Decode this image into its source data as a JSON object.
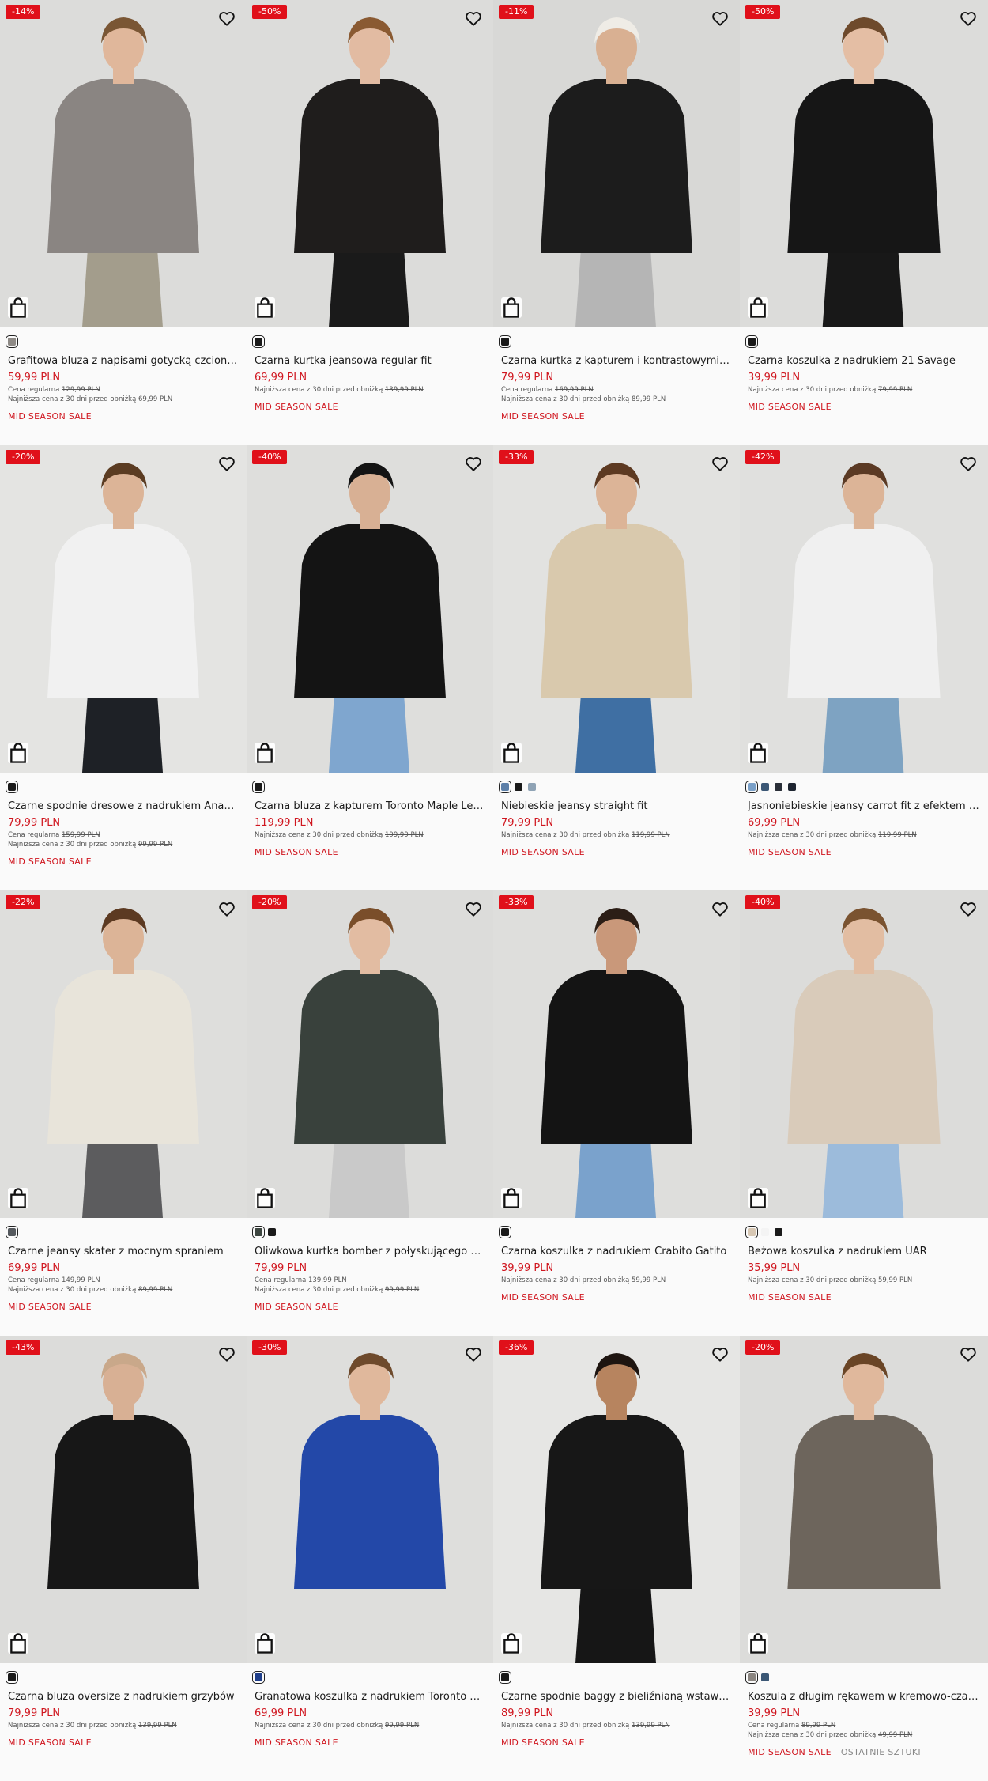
{
  "products": [
    {
      "discount": "-14%",
      "name": "Grafitowa bluza z napisami gotycką czcionką...",
      "price": "59,99 PLN",
      "regular_label": "Cena regularna",
      "regular": "129,99 PLN",
      "lowest_label": "Najniższa cena z 30 dni przed obniżką",
      "lowest": "69,99 PLN",
      "promo": "MID SEASON SALE",
      "swatches": [
        "#8e8a86"
      ],
      "bg": "#dcdcda",
      "top": "#8a8582",
      "bottom": "#a39d8c",
      "hair": "#7a5634",
      "skin": "#e0b79b",
      "legs": true
    },
    {
      "discount": "-50%",
      "name": "Czarna kurtka jeansowa regular fit",
      "price": "69,99 PLN",
      "lowest_label": "Najniższa cena z 30 dni przed obniżką",
      "lowest": "139,99 PLN",
      "promo": "MID SEASON SALE",
      "swatches": [
        "#1a1a1a"
      ],
      "bg": "#dcdcda",
      "top": "#1f1d1c",
      "bottom": "#1a1a1a",
      "hair": "#8a5a32",
      "skin": "#e2bba2",
      "legs": true
    },
    {
      "discount": "-11%",
      "name": "Czarna kurtka z kapturem i kontrastowymi ...",
      "price": "79,99 PLN",
      "regular_label": "Cena regularna",
      "regular": "169,99 PLN",
      "lowest_label": "Najniższa cena z 30 dni przed obniżką",
      "lowest": "89,99 PLN",
      "promo": "MID SEASON SALE",
      "swatches": [
        "#1a1a1a"
      ],
      "bg": "#d8d8d6",
      "top": "#1c1c1c",
      "bottom": "#b5b5b5",
      "hair": "#efece6",
      "skin": "#d9b092",
      "legs": true
    },
    {
      "discount": "-50%",
      "name": "Czarna koszulka z nadrukiem 21 Savage",
      "price": "39,99 PLN",
      "lowest_label": "Najniższa cena z 30 dni przed obniżką",
      "lowest": "79,99 PLN",
      "promo": "MID SEASON SALE",
      "swatches": [
        "#1a1a1a"
      ],
      "bg": "#dcdcda",
      "top": "#161616",
      "bottom": "#181818",
      "hair": "#6e4a2c",
      "skin": "#e4bea4",
      "legs": true
    },
    {
      "discount": "-20%",
      "name": "Czarne spodnie dresowe z nadrukiem Anah...",
      "price": "79,99 PLN",
      "regular_label": "Cena regularna",
      "regular": "159,99 PLN",
      "lowest_label": "Najniższa cena z 30 dni przed obniżką",
      "lowest": "99,99 PLN",
      "promo": "MID SEASON SALE",
      "swatches": [
        "#1a1a1a"
      ],
      "bg": "#e4e4e2",
      "top": "#f1f1f1",
      "bottom": "#1e2126",
      "hair": "#5b3c22",
      "skin": "#dcb497",
      "legs": true
    },
    {
      "discount": "-40%",
      "name": "Czarna bluza z kapturem Toronto Maple Leafs",
      "price": "119,99 PLN",
      "lowest_label": "Najniższa cena z 30 dni przed obniżką",
      "lowest": "199,99 PLN",
      "promo": "MID SEASON SALE",
      "swatches": [
        "#1a1a1a"
      ],
      "bg": "#dededc",
      "top": "#141414",
      "bottom": "#7fa6cf",
      "hair": "#141414",
      "skin": "#d8b094",
      "legs": true
    },
    {
      "discount": "-33%",
      "name": "Niebieskie jeansy straight fit",
      "price": "79,99 PLN",
      "lowest_label": "Najniższa cena z 30 dni przed obniżką",
      "lowest": "119,99 PLN",
      "promo": "MID SEASON SALE",
      "swatches": [
        "#5c7fa8",
        "#1a1a1a",
        "#8fa3b5"
      ],
      "bg": "#e2e2e0",
      "top": "#d9c9ad",
      "bottom": "#3f6fa3",
      "hair": "#5d3a22",
      "skin": "#dcb497",
      "legs": true
    },
    {
      "discount": "-42%",
      "name": "Jasnoniebieskie jeansy carrot fit z efektem s...",
      "price": "69,99 PLN",
      "lowest_label": "Najniższa cena z 30 dni przed obniżką",
      "lowest": "119,99 PLN",
      "promo": "MID SEASON SALE",
      "swatches": [
        "#7aa0c8",
        "#3b5775",
        "#2a2f38",
        "#1d2430"
      ],
      "bg": "#e0e0de",
      "top": "#f0f0f0",
      "bottom": "#7ea3c2",
      "hair": "#5b3a24",
      "skin": "#dcb497",
      "legs": true
    },
    {
      "discount": "-22%",
      "name": "Czarne jeansy skater z mocnym spraniem",
      "price": "69,99 PLN",
      "regular_label": "Cena regularna",
      "regular": "149,99 PLN",
      "lowest_label": "Najniższa cena z 30 dni przed obniżką",
      "lowest": "89,99 PLN",
      "promo": "MID SEASON SALE",
      "swatches": [
        "#55595e"
      ],
      "bg": "#dededc",
      "top": "#e8e4da",
      "bottom": "#5c5c5e",
      "hair": "#5c3a22",
      "skin": "#dcb497",
      "legs": true
    },
    {
      "discount": "-20%",
      "name": "Oliwkowa kurtka bomber z połyskującego m...",
      "price": "79,99 PLN",
      "regular_label": "Cena regularna",
      "regular": "139,99 PLN",
      "lowest_label": "Najniższa cena z 30 dni przed obniżką",
      "lowest": "99,99 PLN",
      "promo": "MID SEASON SALE",
      "swatches": [
        "#3d4640",
        "#1a1a1a"
      ],
      "bg": "#dcdcda",
      "top": "#39413c",
      "bottom": "#c9c9c9",
      "hair": "#7a4e2a",
      "skin": "#e2bca2",
      "legs": true
    },
    {
      "discount": "-33%",
      "name": "Czarna koszulka z nadrukiem Crabito Gatito",
      "price": "39,99 PLN",
      "lowest_label": "Najniższa cena z 30 dni przed obniżką",
      "lowest": "59,99 PLN",
      "promo": "MID SEASON SALE",
      "swatches": [
        "#1a1a1a"
      ],
      "bg": "#dededc",
      "top": "#141414",
      "bottom": "#7aa2cc",
      "hair": "#2c1e16",
      "skin": "#c9987a",
      "legs": true
    },
    {
      "discount": "-40%",
      "name": "Beżowa koszulka z nadrukiem UAR",
      "price": "35,99 PLN",
      "lowest_label": "Najniższa cena z 30 dni przed obniżką",
      "lowest": "59,99 PLN",
      "promo": "MID SEASON SALE",
      "swatches": [
        "#d7c7b3",
        "#f4f4f4",
        "#1a1a1a"
      ],
      "bg": "#dcdcda",
      "top": "#d9cbba",
      "bottom": "#9cbbdb",
      "hair": "#7a5330",
      "skin": "#e2bda2",
      "legs": true
    },
    {
      "discount": "-43%",
      "name": "Czarna bluza oversize z nadrukiem grzybów",
      "price": "79,99 PLN",
      "lowest_label": "Najniższa cena z 30 dni przed obniżką",
      "lowest": "139,99 PLN",
      "promo": "MID SEASON SALE",
      "swatches": [
        "#1a1a1a"
      ],
      "bg": "#dcdcda",
      "top": "#171717",
      "bottom": "#b7b4a6",
      "hair": "#c9a88a",
      "skin": "#d8b094",
      "legs": false
    },
    {
      "discount": "-30%",
      "name": "Granatowa koszulka z nadrukiem Toronto Ma...",
      "price": "69,99 PLN",
      "lowest_label": "Najniższa cena z 30 dni przed obniżką",
      "lowest": "99,99 PLN",
      "promo": "MID SEASON SALE",
      "swatches": [
        "#1f3e8a"
      ],
      "bg": "#dededc",
      "top": "#2348a8",
      "bottom": "#1a1a1a",
      "hair": "#6e4a2c",
      "skin": "#e0b89c",
      "legs": false
    },
    {
      "discount": "-36%",
      "name": "Czarne spodnie baggy z bieliźnianą wstawką...",
      "price": "89,99 PLN",
      "lowest_label": "Najniższa cena z 30 dni przed obniżką",
      "lowest": "139,99 PLN",
      "promo": "MID SEASON SALE",
      "swatches": [
        "#1a1a1a"
      ],
      "bg": "#e6e6e4",
      "top": "#171717",
      "bottom": "#161616",
      "hair": "#1e1510",
      "skin": "#b7845f",
      "legs": true
    },
    {
      "discount": "-20%",
      "name": "Koszula z długim rękawem w kremowo-czar...",
      "price": "39,99 PLN",
      "regular_label": "Cena regularna",
      "regular": "89,99 PLN",
      "lowest_label": "Najniższa cena z 30 dni przed obniżką",
      "lowest": "49,99 PLN",
      "promo": "MID SEASON SALE",
      "last": "OSTATNIE SZTUKI",
      "swatches": [
        "#8a8580",
        "#3b5775"
      ],
      "bg": "#dcdcda",
      "top": "#6d655c",
      "bottom": "#2a2a2a",
      "hair": "#6a4526",
      "skin": "#e0b89c",
      "legs": false
    }
  ]
}
